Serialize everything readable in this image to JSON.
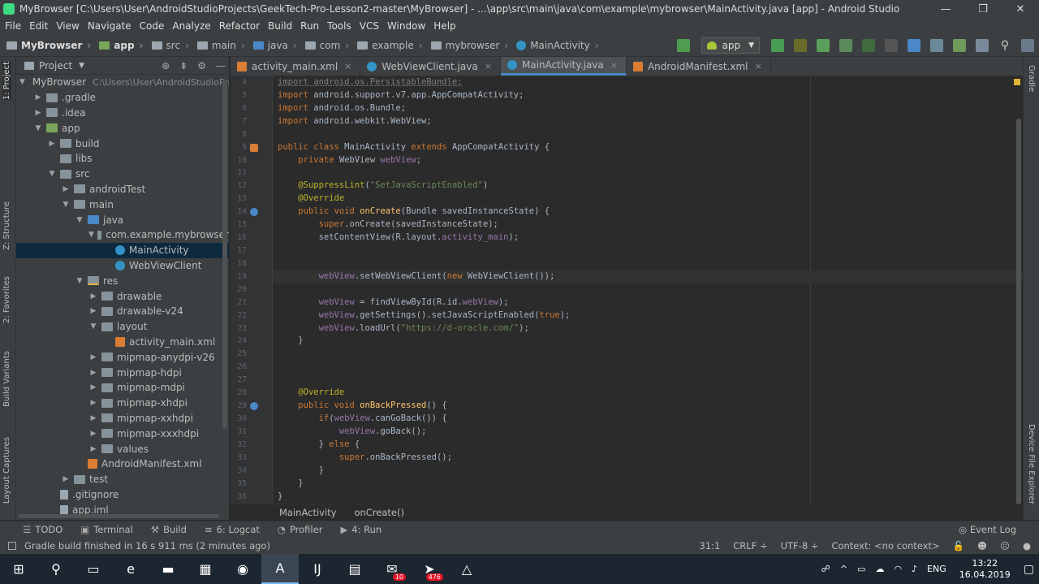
{
  "window": {
    "title": "MyBrowser [C:\\Users\\User\\AndroidStudioProjects\\GeekTech-Pro-Lesson2-master\\MyBrowser] - ...\\app\\src\\main\\java\\com\\example\\mybrowser\\MainActivity.java [app] - Android Studio",
    "controls": [
      "—",
      "❐",
      "✕"
    ]
  },
  "menu": [
    "File",
    "Edit",
    "View",
    "Navigate",
    "Code",
    "Analyze",
    "Refactor",
    "Build",
    "Run",
    "Tools",
    "VCS",
    "Window",
    "Help"
  ],
  "breadcrumbs": [
    "MyBrowser",
    "app",
    "src",
    "main",
    "java",
    "com",
    "example",
    "mybrowser",
    "MainActivity"
  ],
  "run_config": "app",
  "left_tabs": [
    "1: Project",
    "Z: Structure",
    "2: Favorites",
    "Build Variants",
    "Layout Captures"
  ],
  "right_tabs": [
    "Gradle",
    "Device File Explorer"
  ],
  "project_panel": {
    "header": "Project",
    "root_path": "C:\\Users\\User\\AndroidStudioPro",
    "tree": [
      {
        "label": "MyBrowser",
        "indent": 0,
        "arrow": "▼",
        "icon": "folder"
      },
      {
        "label": ".gradle",
        "indent": 1,
        "arrow": "▶",
        "icon": "folder"
      },
      {
        "label": ".idea",
        "indent": 1,
        "arrow": "▶",
        "icon": "folder"
      },
      {
        "label": "app",
        "indent": 1,
        "arrow": "▼",
        "icon": "droidmod"
      },
      {
        "label": "build",
        "indent": 2,
        "arrow": "▶",
        "icon": "folder"
      },
      {
        "label": "libs",
        "indent": 2,
        "arrow": "",
        "icon": "folder"
      },
      {
        "label": "src",
        "indent": 2,
        "arrow": "▼",
        "icon": "folder"
      },
      {
        "label": "androidTest",
        "indent": 3,
        "arrow": "▶",
        "icon": "folder"
      },
      {
        "label": "main",
        "indent": 3,
        "arrow": "▼",
        "icon": "folder"
      },
      {
        "label": "java",
        "indent": 4,
        "arrow": "▼",
        "icon": "javafolder"
      },
      {
        "label": "com.example.mybrowser",
        "indent": 5,
        "arrow": "▼",
        "icon": "folder"
      },
      {
        "label": "MainActivity",
        "indent": 6,
        "arrow": "",
        "icon": "cls",
        "selected": true
      },
      {
        "label": "WebViewClient",
        "indent": 6,
        "arrow": "",
        "icon": "cls"
      },
      {
        "label": "res",
        "indent": 4,
        "arrow": "▼",
        "icon": "resfolder"
      },
      {
        "label": "drawable",
        "indent": 5,
        "arrow": "▶",
        "icon": "folder"
      },
      {
        "label": "drawable-v24",
        "indent": 5,
        "arrow": "▶",
        "icon": "folder"
      },
      {
        "label": "layout",
        "indent": 5,
        "arrow": "▼",
        "icon": "folder"
      },
      {
        "label": "activity_main.xml",
        "indent": 6,
        "arrow": "",
        "icon": "xml"
      },
      {
        "label": "mipmap-anydpi-v26",
        "indent": 5,
        "arrow": "▶",
        "icon": "folder"
      },
      {
        "label": "mipmap-hdpi",
        "indent": 5,
        "arrow": "▶",
        "icon": "folder"
      },
      {
        "label": "mipmap-mdpi",
        "indent": 5,
        "arrow": "▶",
        "icon": "folder"
      },
      {
        "label": "mipmap-xhdpi",
        "indent": 5,
        "arrow": "▶",
        "icon": "folder"
      },
      {
        "label": "mipmap-xxhdpi",
        "indent": 5,
        "arrow": "▶",
        "icon": "folder"
      },
      {
        "label": "mipmap-xxxhdpi",
        "indent": 5,
        "arrow": "▶",
        "icon": "folder"
      },
      {
        "label": "values",
        "indent": 5,
        "arrow": "▶",
        "icon": "folder"
      },
      {
        "label": "AndroidManifest.xml",
        "indent": 4,
        "arrow": "",
        "icon": "xml"
      },
      {
        "label": "test",
        "indent": 3,
        "arrow": "▶",
        "icon": "folder"
      },
      {
        "label": ".gitignore",
        "indent": 2,
        "arrow": "",
        "icon": "file"
      },
      {
        "label": "app.iml",
        "indent": 2,
        "arrow": "",
        "icon": "file"
      }
    ]
  },
  "editor_tabs": [
    {
      "label": "activity_main.xml",
      "icon": "xml",
      "active": false
    },
    {
      "label": "WebViewClient.java",
      "icon": "cls",
      "active": false
    },
    {
      "label": "MainActivity.java",
      "icon": "cls",
      "active": true
    },
    {
      "label": "AndroidManifest.xml",
      "icon": "xml",
      "active": false
    }
  ],
  "code_lines": [
    {
      "n": "4",
      "html": "<span class=\"dep\">import android.os.PersistableBundle;</span>"
    },
    {
      "n": "5",
      "html": "<span class=\"kw\">import</span> android.support.v7.app.AppCompatActivity;"
    },
    {
      "n": "6",
      "html": "<span class=\"kw\">import</span> android.os.Bundle;"
    },
    {
      "n": "7",
      "html": "<span class=\"kw\">import</span> android.webkit.WebView;"
    },
    {
      "n": "8",
      "html": ""
    },
    {
      "n": "9",
      "html": "<span class=\"kw\">public class</span> MainActivity <span class=\"kw\">extends</span> AppCompatActivity {",
      "gutter": "class"
    },
    {
      "n": "10",
      "html": "    <span class=\"kw\">private</span> WebView <span class=\"fld\">webView</span>;"
    },
    {
      "n": "11",
      "html": ""
    },
    {
      "n": "12",
      "html": "    <span class=\"ann\">@SuppressLint</span>(<span class=\"str\">\"SetJavaScriptEnabled\"</span>)"
    },
    {
      "n": "13",
      "html": "    <span class=\"ann\">@Override</span>"
    },
    {
      "n": "14",
      "html": "    <span class=\"kw\">public void</span> <span class=\"mth\">onCreate</span>(Bundle savedInstanceState) {",
      "gutter": "override"
    },
    {
      "n": "15",
      "html": "        <span class=\"kw\">super</span>.onCreate(savedInstanceState);"
    },
    {
      "n": "16",
      "html": "        setContentView(R.layout.<span class=\"fld\">activity_main</span>);"
    },
    {
      "n": "17",
      "html": ""
    },
    {
      "n": "18",
      "html": ""
    },
    {
      "n": "19",
      "html": "        <span class=\"fld\">webView</span>.setWebViewClient(<span class=\"kw\">new</span> WebViewClient());",
      "current": true
    },
    {
      "n": "20",
      "html": ""
    },
    {
      "n": "21",
      "html": "        <span class=\"fld\">webView</span> = findViewById(R.id.<span class=\"fld\">webView</span>);"
    },
    {
      "n": "22",
      "html": "        <span class=\"fld\">webView</span>.getSettings().setJavaScriptEnabled(<span class=\"kw\">true</span>);"
    },
    {
      "n": "23",
      "html": "        <span class=\"fld\">webView</span>.loadUrl(<span class=\"str\">\"https://d-oracle.com/\"</span>);"
    },
    {
      "n": "24",
      "html": "    }"
    },
    {
      "n": "25",
      "html": ""
    },
    {
      "n": "26",
      "html": ""
    },
    {
      "n": "27",
      "html": ""
    },
    {
      "n": "28",
      "html": "    <span class=\"ann\">@Override</span>"
    },
    {
      "n": "29",
      "html": "    <span class=\"kw\">public void</span> <span class=\"mth\">onBackPressed</span>() {",
      "gutter": "override"
    },
    {
      "n": "30",
      "html": "        <span class=\"kw\">if</span>(<span class=\"fld\">webView</span>.canGoBack()) {"
    },
    {
      "n": "31",
      "html": "            <span class=\"fld\">webView</span>.goBack();"
    },
    {
      "n": "32",
      "html": "        } <span class=\"kw\">else</span> {"
    },
    {
      "n": "33",
      "html": "            <span class=\"kw\">super</span>.onBackPressed();"
    },
    {
      "n": "34",
      "html": "        }"
    },
    {
      "n": "35",
      "html": "    }"
    },
    {
      "n": "36",
      "html": "}"
    }
  ],
  "editor_breadcrumb": [
    "MainActivity",
    "onCreate()"
  ],
  "tool_windows": [
    {
      "glyph": "☰",
      "label": "TODO"
    },
    {
      "glyph": "▣",
      "label": "Terminal"
    },
    {
      "glyph": "⚒",
      "label": "Build"
    },
    {
      "glyph": "≡",
      "label": "6: Logcat"
    },
    {
      "glyph": "◔",
      "label": "Profiler"
    },
    {
      "glyph": "▶",
      "label": "4: Run"
    }
  ],
  "event_log": "Event Log",
  "status": {
    "message": "Gradle build finished in 16 s 911 ms (2 minutes ago)",
    "position": "31:1",
    "line_sep": "CRLF ÷",
    "encoding": "UTF-8 ÷",
    "context": "Context: <no context>"
  },
  "taskbar": {
    "items": [
      {
        "name": "start",
        "glyph": "⊞"
      },
      {
        "name": "search",
        "glyph": "⚲"
      },
      {
        "name": "task-view",
        "glyph": "▭"
      },
      {
        "name": "edge",
        "glyph": "e"
      },
      {
        "name": "explorer",
        "glyph": "▬"
      },
      {
        "name": "store",
        "glyph": "▦"
      },
      {
        "name": "chrome",
        "glyph": "◉"
      },
      {
        "name": "android-studio",
        "glyph": "A",
        "active": true
      },
      {
        "name": "intellij",
        "glyph": "IJ"
      },
      {
        "name": "app-icon",
        "glyph": "▤"
      },
      {
        "name": "mail",
        "glyph": "✉",
        "badge": "10"
      },
      {
        "name": "telegram",
        "glyph": "➤",
        "badge": "476"
      },
      {
        "name": "app-triangle",
        "glyph": "△"
      }
    ],
    "lang": "ENG",
    "time": "13:22",
    "date": "16.04.2019"
  }
}
